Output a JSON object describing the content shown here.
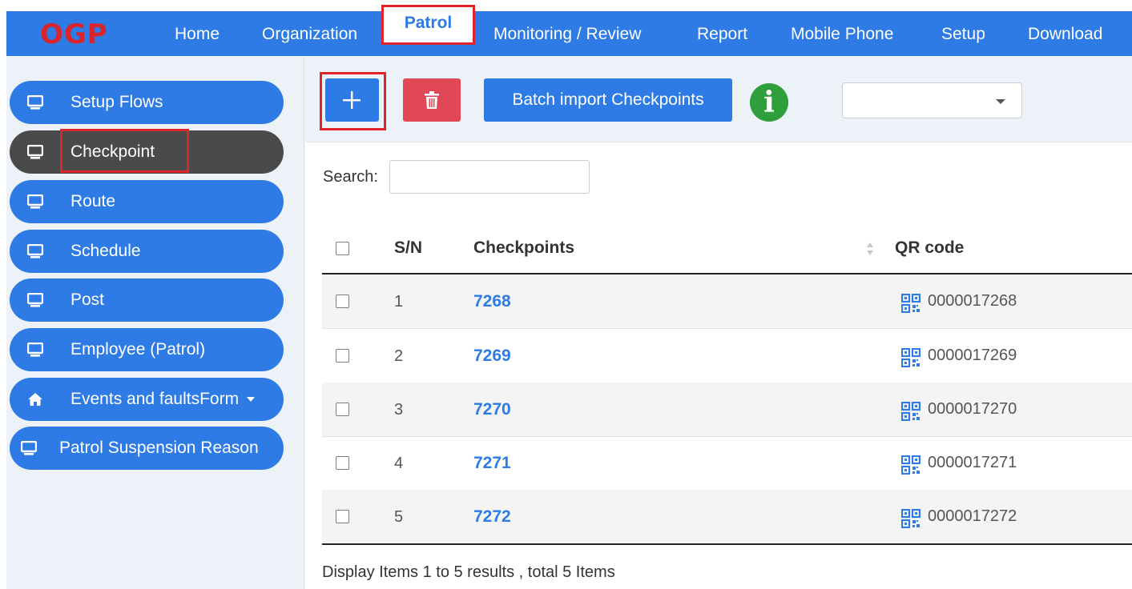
{
  "logo": "OGP",
  "nav": {
    "items": [
      "Home",
      "Organization",
      "Patrol",
      "Monitoring / Review",
      "Report",
      "Mobile Phone",
      "Setup",
      "Download"
    ],
    "active": "Patrol"
  },
  "sidebar": {
    "items": [
      {
        "label": "Setup Flows",
        "icon": "monitor-icon"
      },
      {
        "label": "Checkpoint",
        "icon": "monitor-icon",
        "active": true
      },
      {
        "label": "Route",
        "icon": "monitor-icon"
      },
      {
        "label": "Schedule",
        "icon": "monitor-icon"
      },
      {
        "label": "Post",
        "icon": "monitor-icon"
      },
      {
        "label": "Employee (Patrol)",
        "icon": "monitor-icon"
      },
      {
        "label": "Events and faultsForm",
        "icon": "home-icon",
        "dropdown": true
      },
      {
        "label": "Patrol Suspension Reason",
        "icon": "monitor-icon"
      }
    ]
  },
  "toolbar": {
    "add_label": "+",
    "batch_label": "Batch import Checkpoints",
    "info_label": "i",
    "select_value": ""
  },
  "search": {
    "label": "Search:",
    "value": ""
  },
  "table": {
    "headers": {
      "sn": "S/N",
      "checkpoints": "Checkpoints",
      "qr": "QR code"
    },
    "rows": [
      {
        "sn": "1",
        "checkpoint": "7268",
        "qr": "0000017268"
      },
      {
        "sn": "2",
        "checkpoint": "7269",
        "qr": "0000017269"
      },
      {
        "sn": "3",
        "checkpoint": "7270",
        "qr": "0000017270"
      },
      {
        "sn": "4",
        "checkpoint": "7271",
        "qr": "0000017271"
      },
      {
        "sn": "5",
        "checkpoint": "7272",
        "qr": "0000017272"
      }
    ]
  },
  "footer": "Display Items 1 to 5 results , total 5 Items",
  "colors": {
    "primary": "#2e7be6",
    "danger": "#e04857",
    "active_sidebar": "#4a4a4a",
    "highlight": "#e0242a",
    "info": "#2f9e3c"
  }
}
